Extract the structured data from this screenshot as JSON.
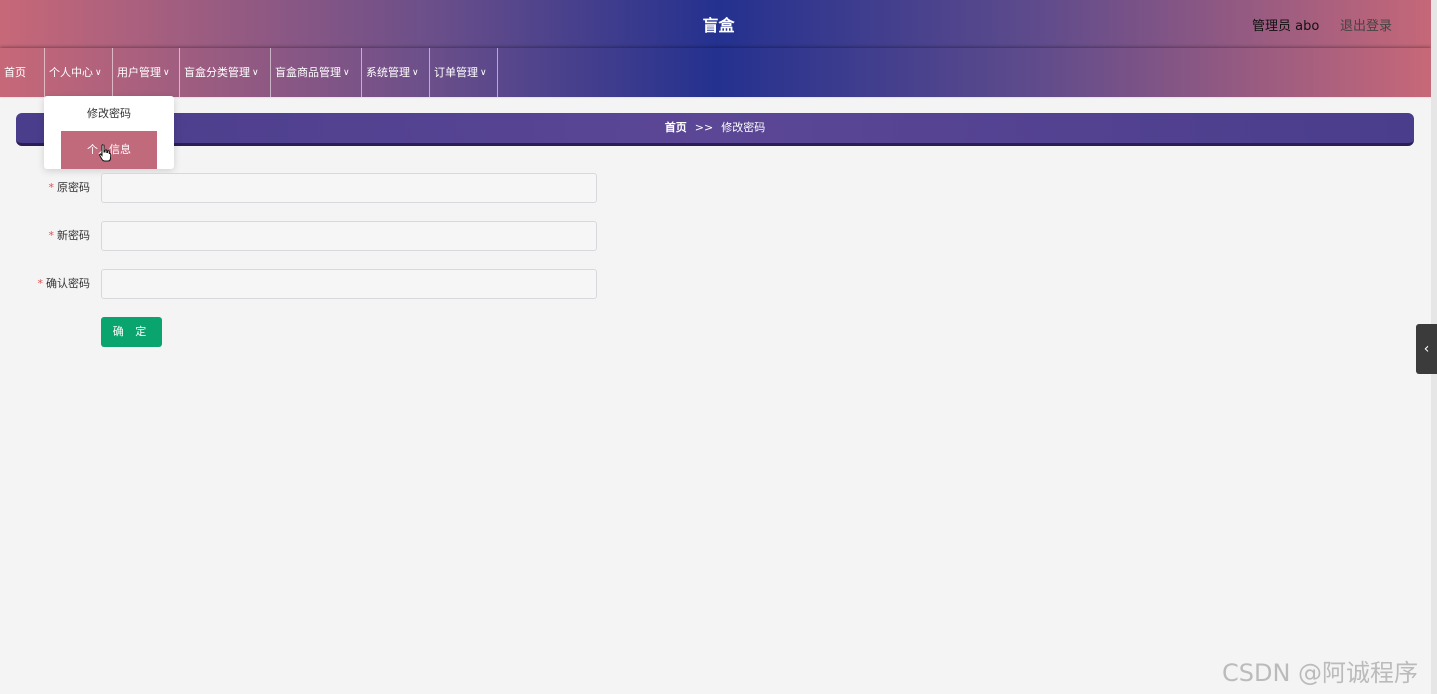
{
  "header": {
    "title": "盲盒",
    "user_label": "管理员 abo",
    "logout_label": "退出登录"
  },
  "nav": {
    "items": [
      {
        "label": "首页"
      },
      {
        "label": "个人中心"
      },
      {
        "label": "用户管理"
      },
      {
        "label": "盲盒分类管理"
      },
      {
        "label": "盲盒商品管理"
      },
      {
        "label": "系统管理"
      },
      {
        "label": "订单管理"
      }
    ],
    "dropdown": [
      {
        "label": "修改密码"
      },
      {
        "label": "个人信息"
      }
    ]
  },
  "breadcrumb": {
    "home": "首页",
    "separator": ">>",
    "current": "修改密码"
  },
  "form": {
    "fields": [
      {
        "label": "原密码",
        "value": ""
      },
      {
        "label": "新密码",
        "value": ""
      },
      {
        "label": "确认密码",
        "value": ""
      }
    ],
    "submit_label": "确 定"
  },
  "colors": {
    "accent_green": "#0aa56e",
    "highlight_pink": "#c06a7c",
    "breadcrumb_purple": "#4a3d8c"
  },
  "icons": {
    "chevron": "chevron-down-icon",
    "side_toggle": "chevron-left-icon"
  },
  "watermark": "CSDN @阿诚程序"
}
